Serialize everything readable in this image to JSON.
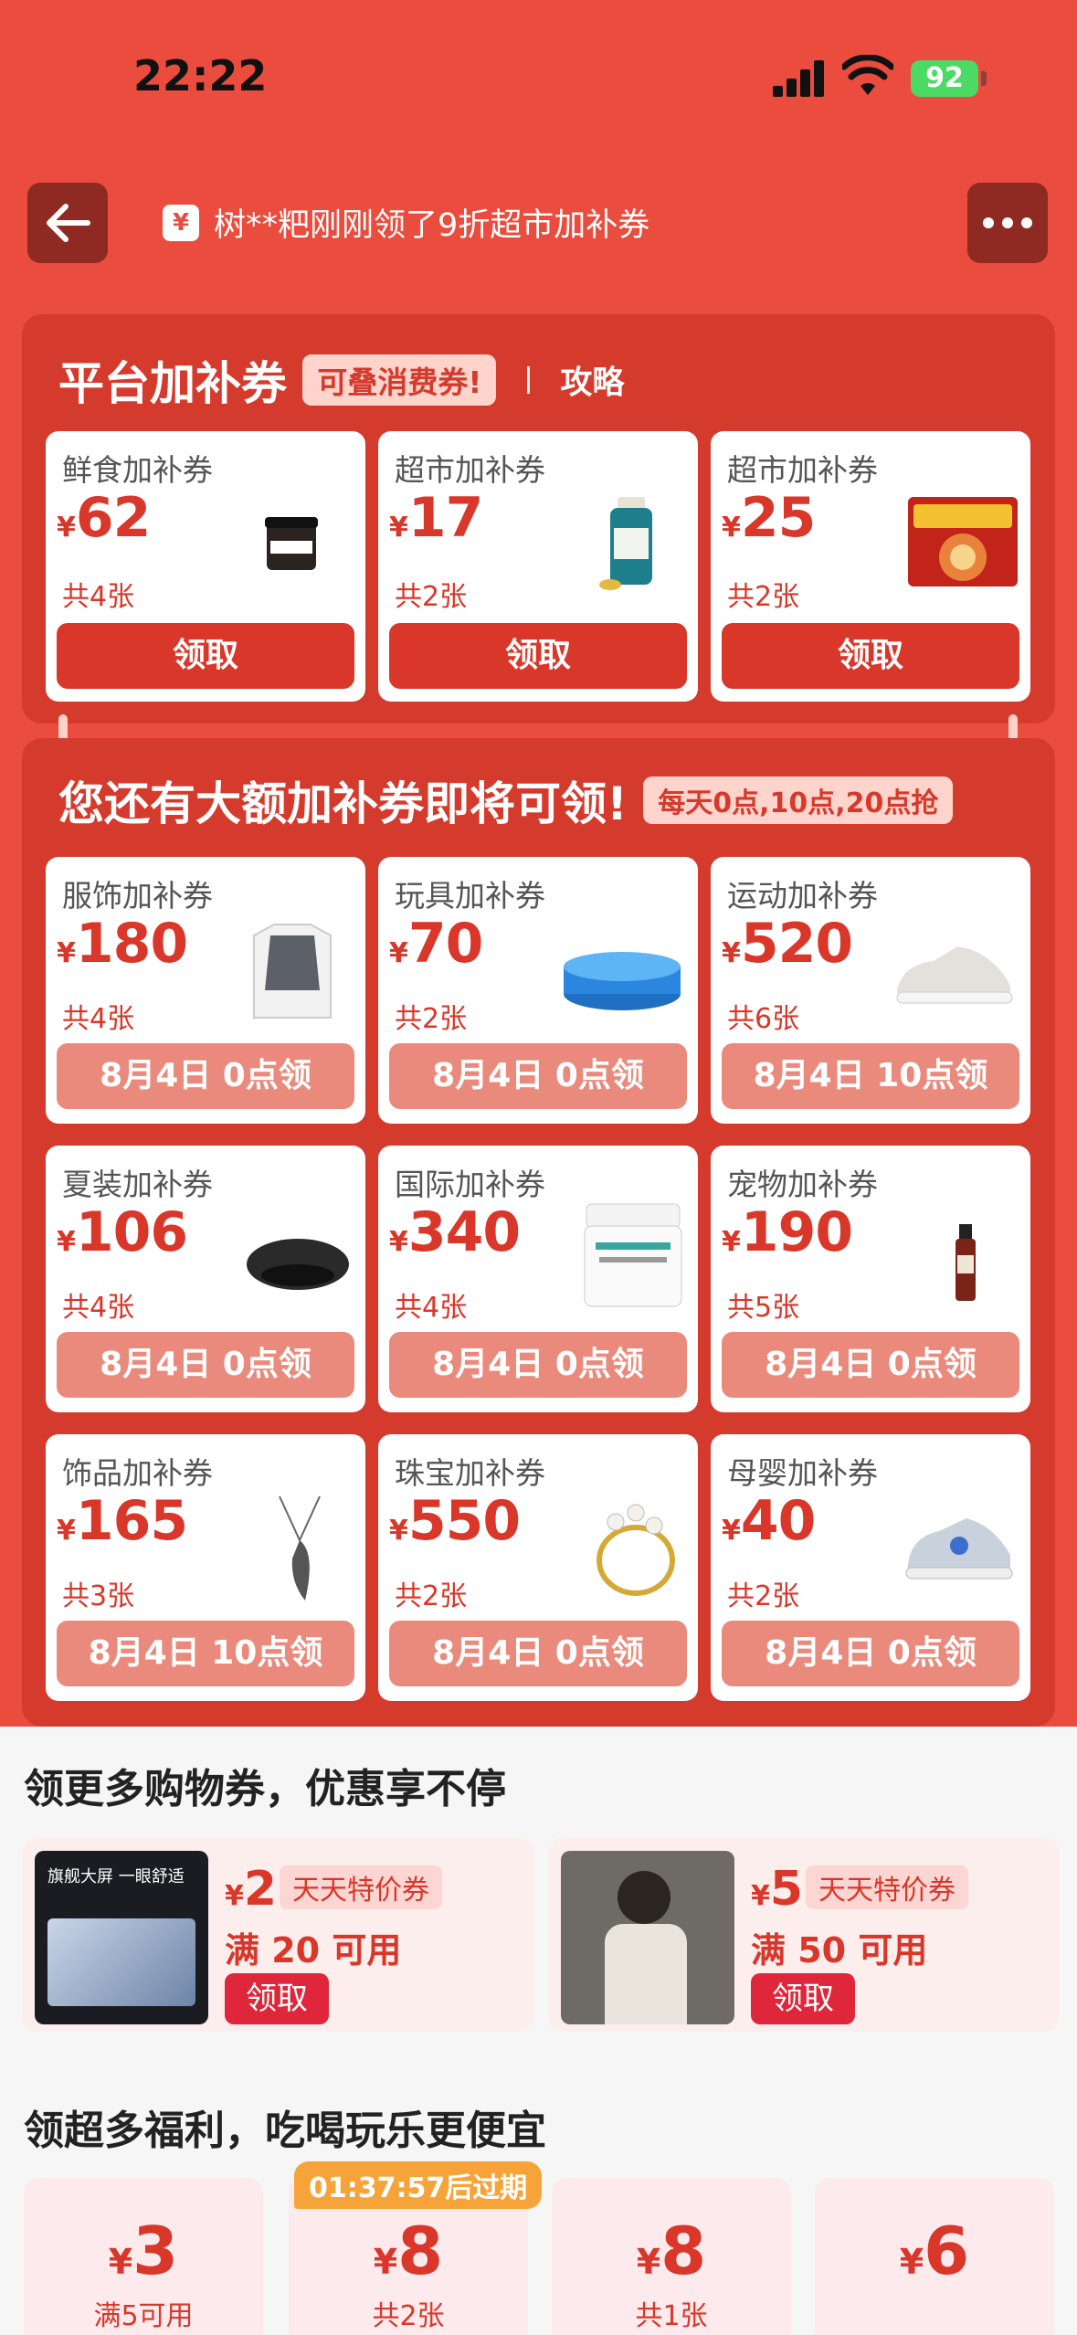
{
  "status_bar": {
    "time": "22:22",
    "battery": "92"
  },
  "header": {
    "ticker_text": "树**粑刚刚领了9折超市加补券",
    "ticker_icon": "¥"
  },
  "platform_section": {
    "title": "平台加补券",
    "tag": "可叠消费券!",
    "link": "攻略",
    "cards": [
      {
        "name": "鲜食加补券",
        "yen": "¥",
        "amount": "62",
        "count": "共4张",
        "button": "领取",
        "icon": "jar-product"
      },
      {
        "name": "超市加补券",
        "yen": "¥",
        "amount": "17",
        "count": "共2张",
        "button": "领取",
        "icon": "supplement-bottle"
      },
      {
        "name": "超市加补券",
        "yen": "¥",
        "amount": "25",
        "count": "共2张",
        "button": "领取",
        "icon": "noodle-pack"
      }
    ]
  },
  "upcoming_section": {
    "title": "您还有大额加补券即将可领!",
    "tag": "每天0点,10点,20点抢",
    "cards": [
      {
        "name": "服饰加补券",
        "yen": "¥",
        "amount": "180",
        "count": "共4张",
        "button": "8月4日 0点领",
        "icon": "sweater-vest"
      },
      {
        "name": "玩具加补券",
        "yen": "¥",
        "amount": "70",
        "count": "共2张",
        "button": "8月4日 0点领",
        "icon": "inflatable-pool"
      },
      {
        "name": "运动加补券",
        "yen": "¥",
        "amount": "520",
        "count": "共6张",
        "button": "8月4日 10点领",
        "icon": "sneaker"
      },
      {
        "name": "夏装加补券",
        "yen": "¥",
        "amount": "106",
        "count": "共4张",
        "button": "8月4日 0点领",
        "icon": "beret-hat"
      },
      {
        "name": "国际加补券",
        "yen": "¥",
        "amount": "340",
        "count": "共4张",
        "button": "8月4日 0点领",
        "icon": "cream-jar"
      },
      {
        "name": "宠物加补券",
        "yen": "¥",
        "amount": "190",
        "count": "共5张",
        "button": "8月4日 0点领",
        "icon": "pet-bottle"
      },
      {
        "name": "饰品加补券",
        "yen": "¥",
        "amount": "165",
        "count": "共3张",
        "button": "8月4日 10点领",
        "icon": "wing-necklace"
      },
      {
        "name": "珠宝加补券",
        "yen": "¥",
        "amount": "550",
        "count": "共2张",
        "button": "8月4日 0点领",
        "icon": "pearl-ring"
      },
      {
        "name": "母婴加补券",
        "yen": "¥",
        "amount": "40",
        "count": "共2张",
        "button": "8月4日 0点领",
        "icon": "kids-shoe"
      }
    ]
  },
  "shopping_section": {
    "title": "领更多购物券，优惠享不停",
    "cards": [
      {
        "yen": "¥",
        "amount": "2",
        "tag": "天天特价券",
        "condition": "满 20 可用",
        "button": "领取",
        "image": "tablet",
        "image_text": "旗舰大屏 一眼舒适"
      },
      {
        "yen": "¥",
        "amount": "5",
        "tag": "天天特价券",
        "condition": "满 50 可用",
        "button": "领取",
        "image": "fashion-model"
      }
    ]
  },
  "perks_section": {
    "title": "领超多福利，吃喝玩乐更便宜",
    "timer": "01:37:57后过期",
    "cards": [
      {
        "yen": "¥",
        "amount": "3",
        "sub": "满5可用"
      },
      {
        "yen": "¥",
        "amount": "8",
        "sub": "共2张"
      },
      {
        "yen": "¥",
        "amount": "8",
        "sub": "共1张"
      },
      {
        "yen": "¥",
        "amount": "6",
        "sub": ""
      }
    ]
  },
  "colors": {
    "brand_red": "#ea4c3e",
    "panel_red": "#d53b2d",
    "price_red": "#d9372a",
    "battery_green": "#4cd964"
  }
}
